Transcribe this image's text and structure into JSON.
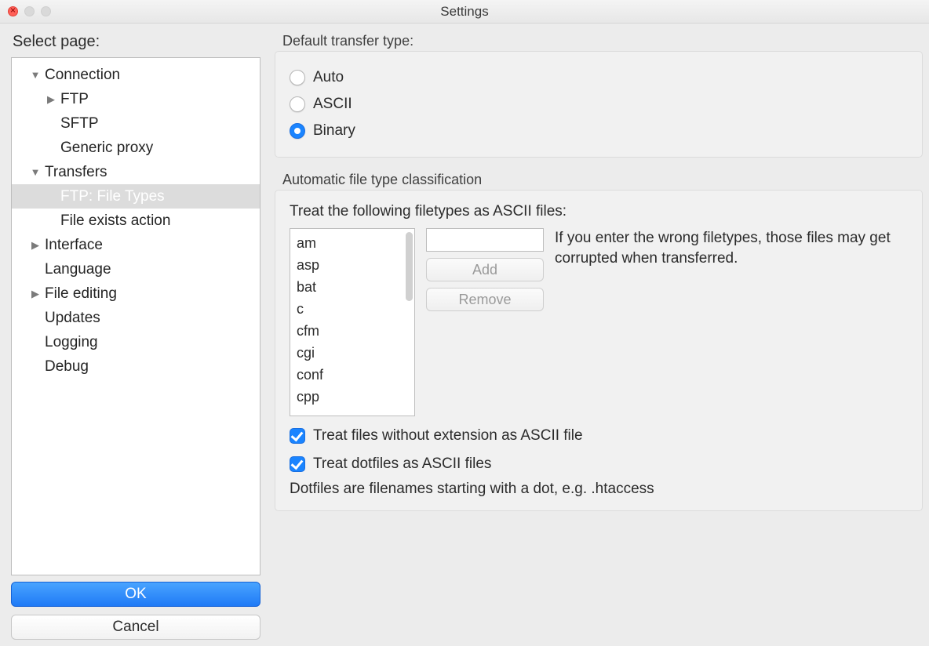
{
  "window": {
    "title": "Settings"
  },
  "sidebar": {
    "label": "Select page:",
    "items": [
      {
        "label": "Connection",
        "level": 1,
        "arrow": "down"
      },
      {
        "label": "FTP",
        "level": 2,
        "arrow": "right"
      },
      {
        "label": "SFTP",
        "level": 2,
        "arrow": ""
      },
      {
        "label": "Generic proxy",
        "level": 2,
        "arrow": ""
      },
      {
        "label": "Transfers",
        "level": 1,
        "arrow": "down"
      },
      {
        "label": "FTP: File Types",
        "level": 2,
        "arrow": "",
        "selected": true
      },
      {
        "label": "File exists action",
        "level": 2,
        "arrow": ""
      },
      {
        "label": "Interface",
        "level": 1,
        "arrow": "right"
      },
      {
        "label": "Language",
        "level": 1,
        "arrow": ""
      },
      {
        "label": "File editing",
        "level": 1,
        "arrow": "right"
      },
      {
        "label": "Updates",
        "level": 1,
        "arrow": ""
      },
      {
        "label": "Logging",
        "level": 1,
        "arrow": ""
      },
      {
        "label": "Debug",
        "level": 1,
        "arrow": ""
      }
    ],
    "ok": "OK",
    "cancel": "Cancel"
  },
  "transferType": {
    "groupLabel": "Default transfer type:",
    "options": {
      "auto": "Auto",
      "ascii": "ASCII",
      "binary": "Binary"
    },
    "selected": "binary"
  },
  "classification": {
    "groupLabel": "Automatic file type classification",
    "note": "Treat the following filetypes as ASCII files:",
    "filetypes": [
      "am",
      "asp",
      "bat",
      "c",
      "cfm",
      "cgi",
      "conf",
      "cpp"
    ],
    "newTypeValue": "",
    "addLabel": "Add",
    "removeLabel": "Remove",
    "warning": "If you enter the wrong filetypes, those files may get corrupted when transferred.",
    "chkNoExtLabel": "Treat files without extension as ASCII file",
    "chkDotfilesLabel": "Treat dotfiles as ASCII files",
    "dotfilesHint": "Dotfiles are filenames starting with a dot, e.g. .htaccess"
  }
}
